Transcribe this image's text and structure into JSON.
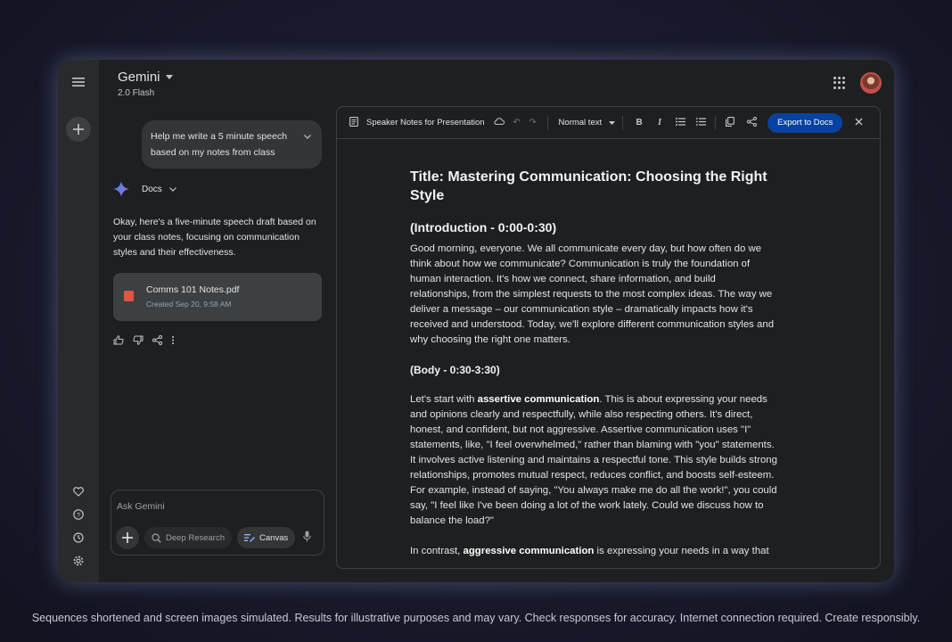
{
  "header": {
    "title": "Gemini",
    "model": "2.0 Flash"
  },
  "chat": {
    "user_message": "Help me write a 5 minute speech based on my notes from class",
    "response_source": "Docs",
    "response_text": "Okay, here's a five-minute speech draft based on your class notes, focusing on communication styles and their effectiveness.",
    "file": {
      "name": "Comms 101 Notes.pdf",
      "meta": "Created Sep 20, 9:58 AM"
    },
    "input_placeholder": "Ask Gemini",
    "tools": {
      "deep_research": "Deep Research",
      "canvas": "Canvas"
    }
  },
  "doc": {
    "name": "Speaker Notes for Presentation",
    "style_select": "Normal text",
    "export_label": "Export to Docs",
    "title": "Title: Mastering Communication: Choosing the Right Style",
    "intro_heading": "(Introduction - 0:00-0:30)",
    "intro_text": "Good morning, everyone. We all communicate every day, but how often do we think about how we communicate? Communication is truly the foundation of human interaction. It's how we connect, share information, and build relationships, from the simplest requests to the most complex ideas. The way we deliver a message – our communication style – dramatically impacts how it's received and understood. Today, we'll explore different communication styles and why choosing the right one matters.",
    "body_heading": "(Body - 0:30-3:30)",
    "body_p1_pre": "Let's start with ",
    "body_p1_bold": "assertive communication",
    "body_p1_post": ". This is about expressing your needs and opinions clearly and respectfully, while also respecting others. It's direct, honest, and confident, but not aggressive. Assertive communication uses \"I\" statements, like, \"I feel overwhelmed,\" rather than blaming with \"you\" statements. It involves active listening and maintains a respectful tone. This style builds strong relationships, promotes mutual respect, reduces conflict, and boosts self-esteem. For example, instead of saying, \"You always make me do all the work!\", you could say, \"I feel like I've been doing a lot of the work lately. Could we discuss how to balance the load?\"",
    "body_p2_pre": "In contrast, ",
    "body_p2_bold": "aggressive communication",
    "body_p2_post": " is expressing your needs in a way that"
  },
  "disclaimer": "Sequences shortened and screen images simulated. Results for illustrative purposes and may vary. Check responses for accuracy. Internet connection required. Create responsibly.",
  "colors": {
    "accent_button": "#0842a0",
    "pdf_red": "#e25544",
    "sparkle": "#4285f4"
  }
}
